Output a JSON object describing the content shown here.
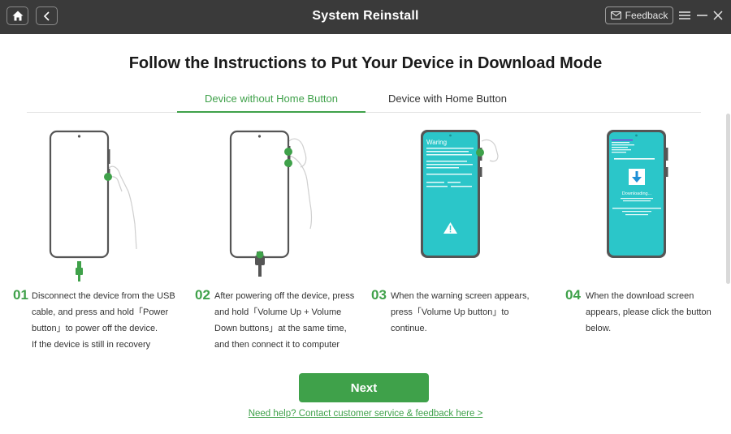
{
  "window": {
    "title": "System Reinstall",
    "feedback_label": "Feedback"
  },
  "page": {
    "heading": "Follow the Instructions to Put Your Device in Download Mode",
    "tabs": [
      {
        "label": "Device without Home Button",
        "active": true
      },
      {
        "label": "Device with Home Button",
        "active": false
      }
    ]
  },
  "steps": [
    {
      "num": "01",
      "text": "Disconnect the device from the USB\ncable, and press and hold「Power\nbutton」to power off the device.\n If the device is still in recovery"
    },
    {
      "num": "02",
      "text": "After powering off the device, press\nand hold「Volume Up + Volume\nDown buttons」at the same time,\nand then connect it to computer"
    },
    {
      "num": "03",
      "text": "When the warning screen appears,\npress「Volume Up button」to\ncontinue."
    },
    {
      "num": "04",
      "text": "When the download screen\nappears, please click the button\nbelow."
    }
  ],
  "screens": {
    "warning_title": "Waring",
    "downloading_label": "Downloading..."
  },
  "actions": {
    "next_label": "Next",
    "help_link": "Need help? Contact customer service & feedback here >"
  },
  "colors": {
    "accent": "#3fa14a",
    "titlebar": "#3a3a3a",
    "phone_screen": "#2bc6c9"
  }
}
